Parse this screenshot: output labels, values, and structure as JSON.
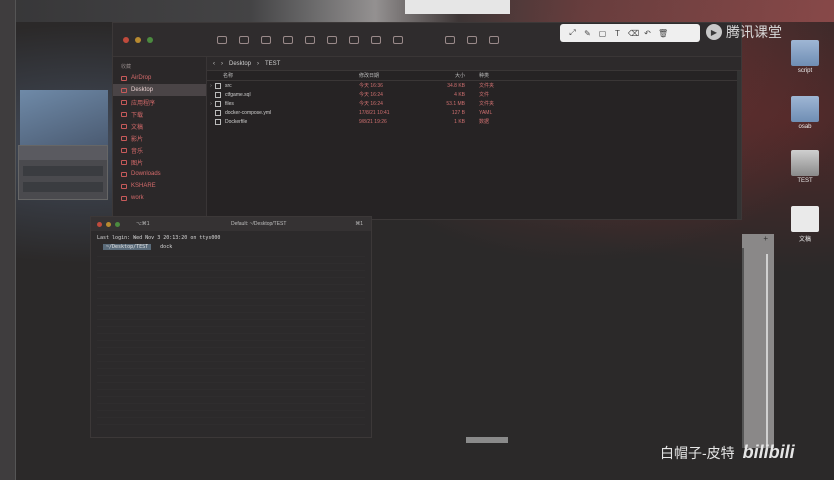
{
  "finder": {
    "path": [
      "Desktop",
      "TEST"
    ],
    "sidebar_heading": "收藏",
    "sidebar_items": [
      {
        "label": "AirDrop"
      },
      {
        "label": "Desktop",
        "active": true
      },
      {
        "label": "应用程序"
      },
      {
        "label": "下载"
      },
      {
        "label": "文稿"
      },
      {
        "label": "影片"
      },
      {
        "label": "音乐"
      },
      {
        "label": "图片"
      },
      {
        "label": "Downloads"
      },
      {
        "label": "KSHARE"
      },
      {
        "label": "work"
      }
    ],
    "columns": {
      "name": "名称",
      "date": "修改日期",
      "size": "大小",
      "kind": "种类"
    },
    "rows": [
      {
        "twisty": "›",
        "name": "src",
        "date": "今天 16:36",
        "size": "34.8 KB",
        "kind": "文件夹"
      },
      {
        "twisty": "",
        "name": "ctfgame.sql",
        "date": "今天 16:24",
        "size": "4 KB",
        "kind": "文件"
      },
      {
        "twisty": "›",
        "name": "files",
        "date": "今天 16:24",
        "size": "53.1 MB",
        "kind": "文件夹"
      },
      {
        "twisty": "",
        "name": "docker-compose.yml",
        "date": "17/8/21 10:41",
        "size": "127 B",
        "kind": "YAML"
      },
      {
        "twisty": "",
        "name": "Dockerfile",
        "date": "9/8/21 19:26",
        "size": "1 KB",
        "kind": "数据"
      }
    ]
  },
  "terminal": {
    "tab": "⌥⌘1",
    "title": "Default: ~/Desktop/TEST",
    "right": "⌘1",
    "last_login": "Last login: Wed Nov  3 20:13:20 on ttys000",
    "prompt": {
      "seg_a": " ",
      "seg_b": "~/Desktop/TEST",
      "seg_c": "",
      "cmd": "dock"
    }
  },
  "annotation_tools": [
    "⤢",
    "✎",
    "▢",
    "T",
    "⌫",
    "↶",
    "🗑"
  ],
  "tencent": {
    "text": "腾讯课堂"
  },
  "desktop_icons": [
    {
      "label": "script",
      "kind": "folder"
    },
    {
      "label": "osab",
      "kind": "folder"
    },
    {
      "label": "TEST",
      "kind": "shot"
    },
    {
      "label": "文稿",
      "kind": "doc"
    }
  ],
  "watermark": {
    "text": "白帽子-皮特",
    "brand": "bilibili"
  },
  "right_panel": {
    "label": "+"
  }
}
